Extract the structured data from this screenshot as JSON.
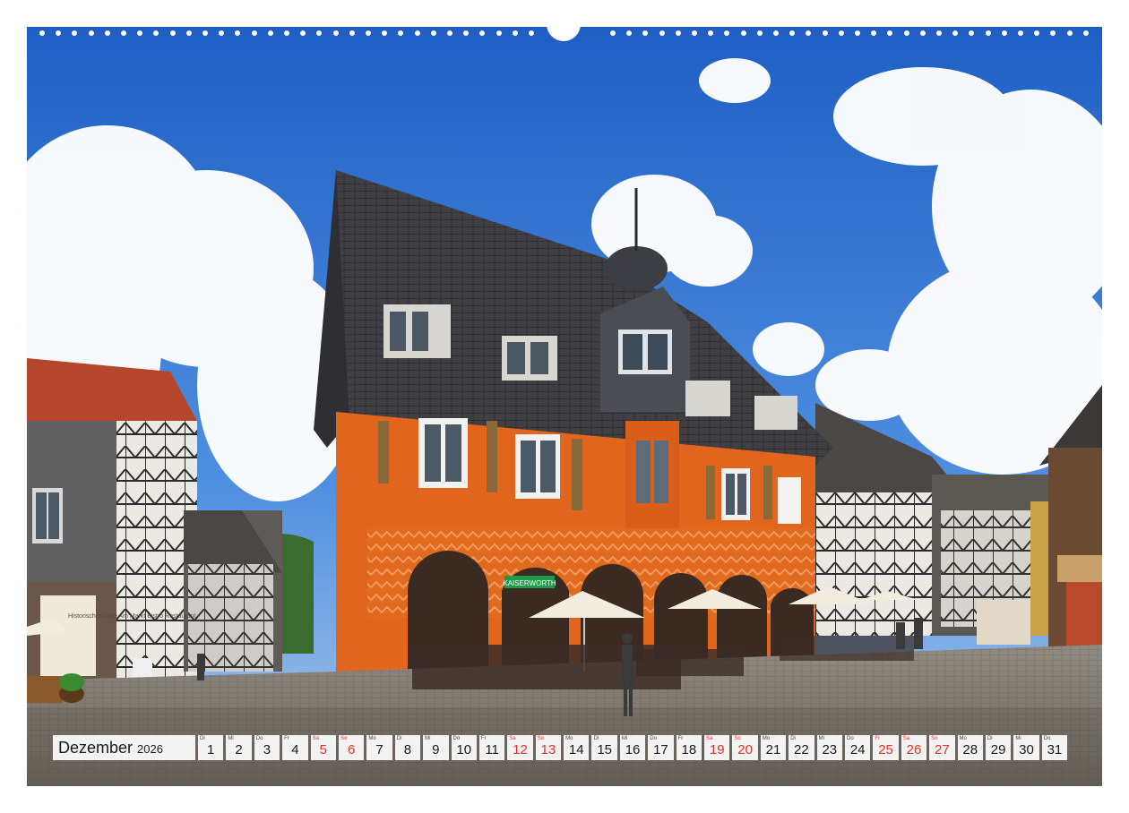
{
  "calendar": {
    "month": "Dezember",
    "year": "2026",
    "weekend_color": "#e0302a",
    "days": [
      {
        "wd": "Di",
        "n": "1",
        "red": false
      },
      {
        "wd": "Mi",
        "n": "2",
        "red": false
      },
      {
        "wd": "Do",
        "n": "3",
        "red": false
      },
      {
        "wd": "Fr",
        "n": "4",
        "red": false
      },
      {
        "wd": "Sa",
        "n": "5",
        "red": true
      },
      {
        "wd": "So",
        "n": "6",
        "red": true
      },
      {
        "wd": "Mo",
        "n": "7",
        "red": false
      },
      {
        "wd": "Di",
        "n": "8",
        "red": false
      },
      {
        "wd": "Mi",
        "n": "9",
        "red": false
      },
      {
        "wd": "Do",
        "n": "10",
        "red": false
      },
      {
        "wd": "Fr",
        "n": "11",
        "red": false
      },
      {
        "wd": "Sa",
        "n": "12",
        "red": true
      },
      {
        "wd": "So",
        "n": "13",
        "red": true
      },
      {
        "wd": "Mo",
        "n": "14",
        "red": false
      },
      {
        "wd": "Di",
        "n": "15",
        "red": false
      },
      {
        "wd": "Mi",
        "n": "16",
        "red": false
      },
      {
        "wd": "Do",
        "n": "17",
        "red": false
      },
      {
        "wd": "Fr",
        "n": "18",
        "red": false
      },
      {
        "wd": "Sa",
        "n": "19",
        "red": true
      },
      {
        "wd": "So",
        "n": "20",
        "red": true
      },
      {
        "wd": "Mo",
        "n": "21",
        "red": false
      },
      {
        "wd": "Di",
        "n": "22",
        "red": false
      },
      {
        "wd": "Mi",
        "n": "23",
        "red": false
      },
      {
        "wd": "Do",
        "n": "24",
        "red": false
      },
      {
        "wd": "Fr",
        "n": "25",
        "red": true
      },
      {
        "wd": "Sa",
        "n": "26",
        "red": true
      },
      {
        "wd": "So",
        "n": "27",
        "red": true
      },
      {
        "wd": "Mo",
        "n": "28",
        "red": false
      },
      {
        "wd": "Di",
        "n": "29",
        "red": false
      },
      {
        "wd": "Mi",
        "n": "30",
        "red": false
      },
      {
        "wd": "Do",
        "n": "31",
        "red": false
      }
    ]
  },
  "photo": {
    "sign_cafe": "Historisches Café Am Markt Bistro Restaurant",
    "sign_green": "KAISERWORTH"
  }
}
